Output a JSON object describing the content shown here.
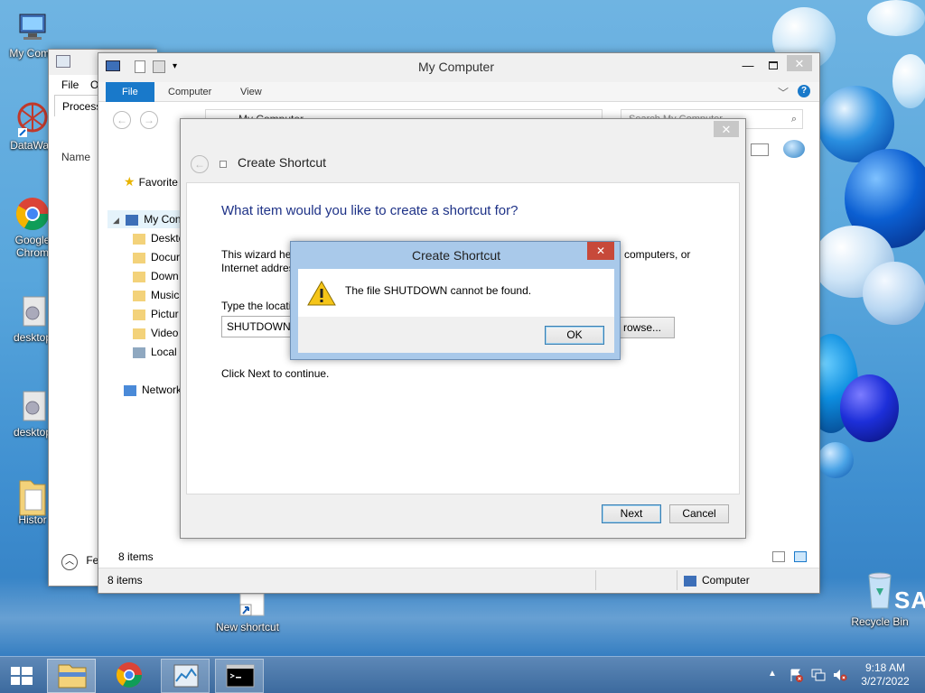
{
  "desktop": {
    "icons": [
      {
        "label": "My Comp",
        "icon": "computer-icon"
      },
      {
        "label": "DataWag",
        "icon": "datawag-icon"
      },
      {
        "label": "Google Chrom",
        "icon": "chrome-icon"
      },
      {
        "label": "desktop",
        "icon": "settings-file-icon"
      },
      {
        "label": "desktop",
        "icon": "settings-file-icon"
      },
      {
        "label": "Histor",
        "icon": "folder-icon"
      },
      {
        "label": "New shortcut",
        "icon": "shortcut-icon"
      },
      {
        "label": "Recycle Bin",
        "icon": "recycle-bin-icon"
      }
    ],
    "brand_text": "SAM"
  },
  "task_manager": {
    "menu_file": "File",
    "menu_options": "O",
    "tab_processes": "Process",
    "col_name": "Name",
    "fewer_details": "Fe"
  },
  "explorer": {
    "title": "My Computer",
    "ribbon_tabs": [
      "File",
      "Computer",
      "View"
    ],
    "address_path": "My Computer",
    "search_placeholder": "Search My Computer",
    "nav": {
      "favorites": "Favorite",
      "my_computer": "My Con",
      "items": [
        "Deskto",
        "Docur",
        "Down",
        "Music",
        "Pictur",
        "Video",
        "Local"
      ],
      "network": "Network"
    },
    "inner_status": "8 items",
    "status_items": "8 items",
    "status_location": "Computer"
  },
  "wizard": {
    "title": "Create Shortcut",
    "heading": "What item would you like to create a shortcut for?",
    "desc_line1_left": "This wizard hel",
    "desc_line1_right": "computers, or",
    "desc_line2_left": "Internet addres",
    "location_label": "Type the locati",
    "location_value": "SHUTDOWN",
    "browse_label": "rowse...",
    "continue_text": "Click Next to continue.",
    "next_label": "Next",
    "cancel_label": "Cancel"
  },
  "error_dialog": {
    "title": "Create Shortcut",
    "message": "The file SHUTDOWN cannot be found.",
    "ok_label": "OK",
    "close_label": "✕"
  },
  "taskbar": {
    "time": "9:18 AM",
    "date": "3/27/2022"
  },
  "colors": {
    "accent": "#1979ca",
    "heading": "#1e3287",
    "dialog_title_bg": "#a9c9ea",
    "close_red": "#c7493a"
  }
}
